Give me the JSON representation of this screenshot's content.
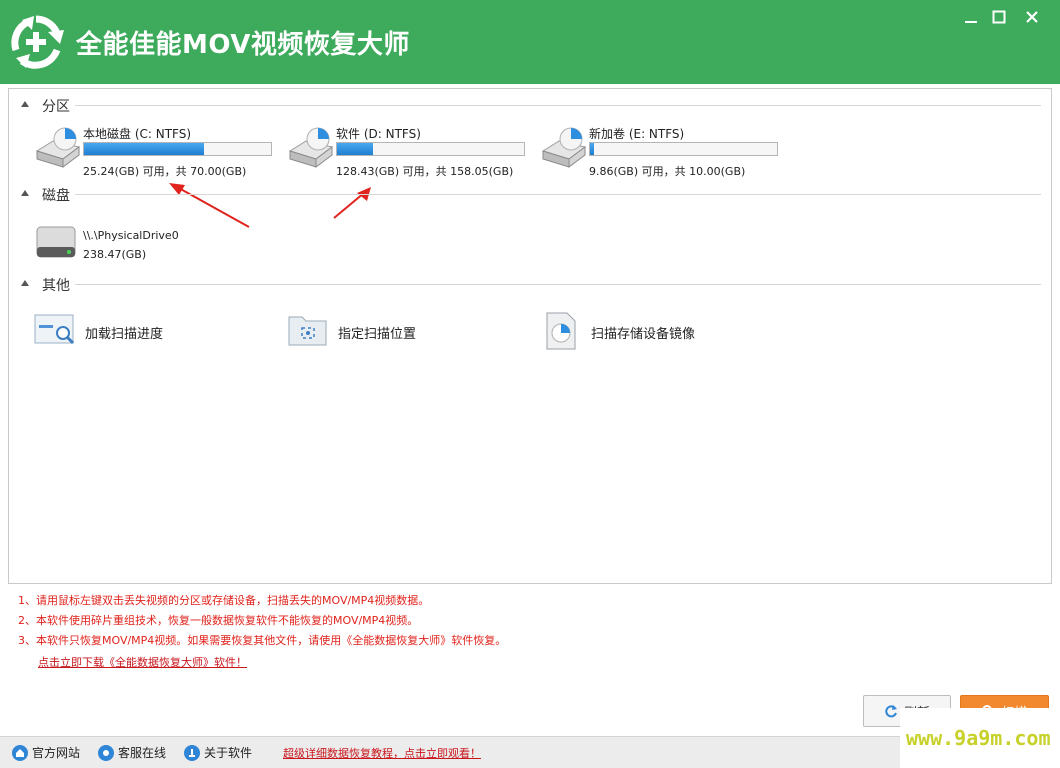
{
  "window": {
    "title": "全能佳能MOV视频恢复大师",
    "accent_color": "#3daa5c"
  },
  "controls": {
    "minimize": "minimize-icon",
    "maximize": "maximize-icon",
    "close": "close-icon"
  },
  "sections": {
    "partitions": {
      "title": "分区",
      "items": [
        {
          "name": "本地磁盘 (C: NTFS)",
          "free_text": "25.24(GB) 可用，共 70.00(GB)",
          "used_fraction": 0.64
        },
        {
          "name": "软件 (D: NTFS)",
          "free_text": "128.43(GB) 可用，共 158.05(GB)",
          "used_fraction": 0.19
        },
        {
          "name": "新加卷 (E: NTFS)",
          "free_text": "9.86(GB) 可用，共 10.00(GB)",
          "used_fraction": 0.02
        }
      ]
    },
    "disks": {
      "title": "磁盘",
      "items": [
        {
          "name": "\\\\.\\PhysicalDrive0",
          "size": "238.47(GB)"
        }
      ]
    },
    "other": {
      "title": "其他",
      "items": [
        {
          "label": "加载扫描进度",
          "icon": "load-scan-progress-icon"
        },
        {
          "label": "指定扫描位置",
          "icon": "folder-scan-location-icon"
        },
        {
          "label": "扫描存储设备镜像",
          "icon": "device-image-icon"
        }
      ]
    }
  },
  "notes": [
    "1、请用鼠标左键双击丢失视频的分区或存储设备，扫描丢失的MOV/MP4视频数据。",
    "2、本软件使用碎片重组技术，恢复一般数据恢复软件不能恢复的MOV/MP4视频。",
    "3、本软件只恢复MOV/MP4视频。如果需要恢复其他文件，请使用《全能数据恢复大师》软件恢复。"
  ],
  "download_link": "点击立即下载《全能数据恢复大师》软件！",
  "buttons": {
    "refresh": "刷新",
    "scan": "扫描"
  },
  "footer": {
    "website": "官方网站",
    "support": "客服在线",
    "about": "关于软件",
    "tutorial_link": "超级详细数据恢复教程，点击立即观看！"
  },
  "watermark": "www.9a9m.com"
}
